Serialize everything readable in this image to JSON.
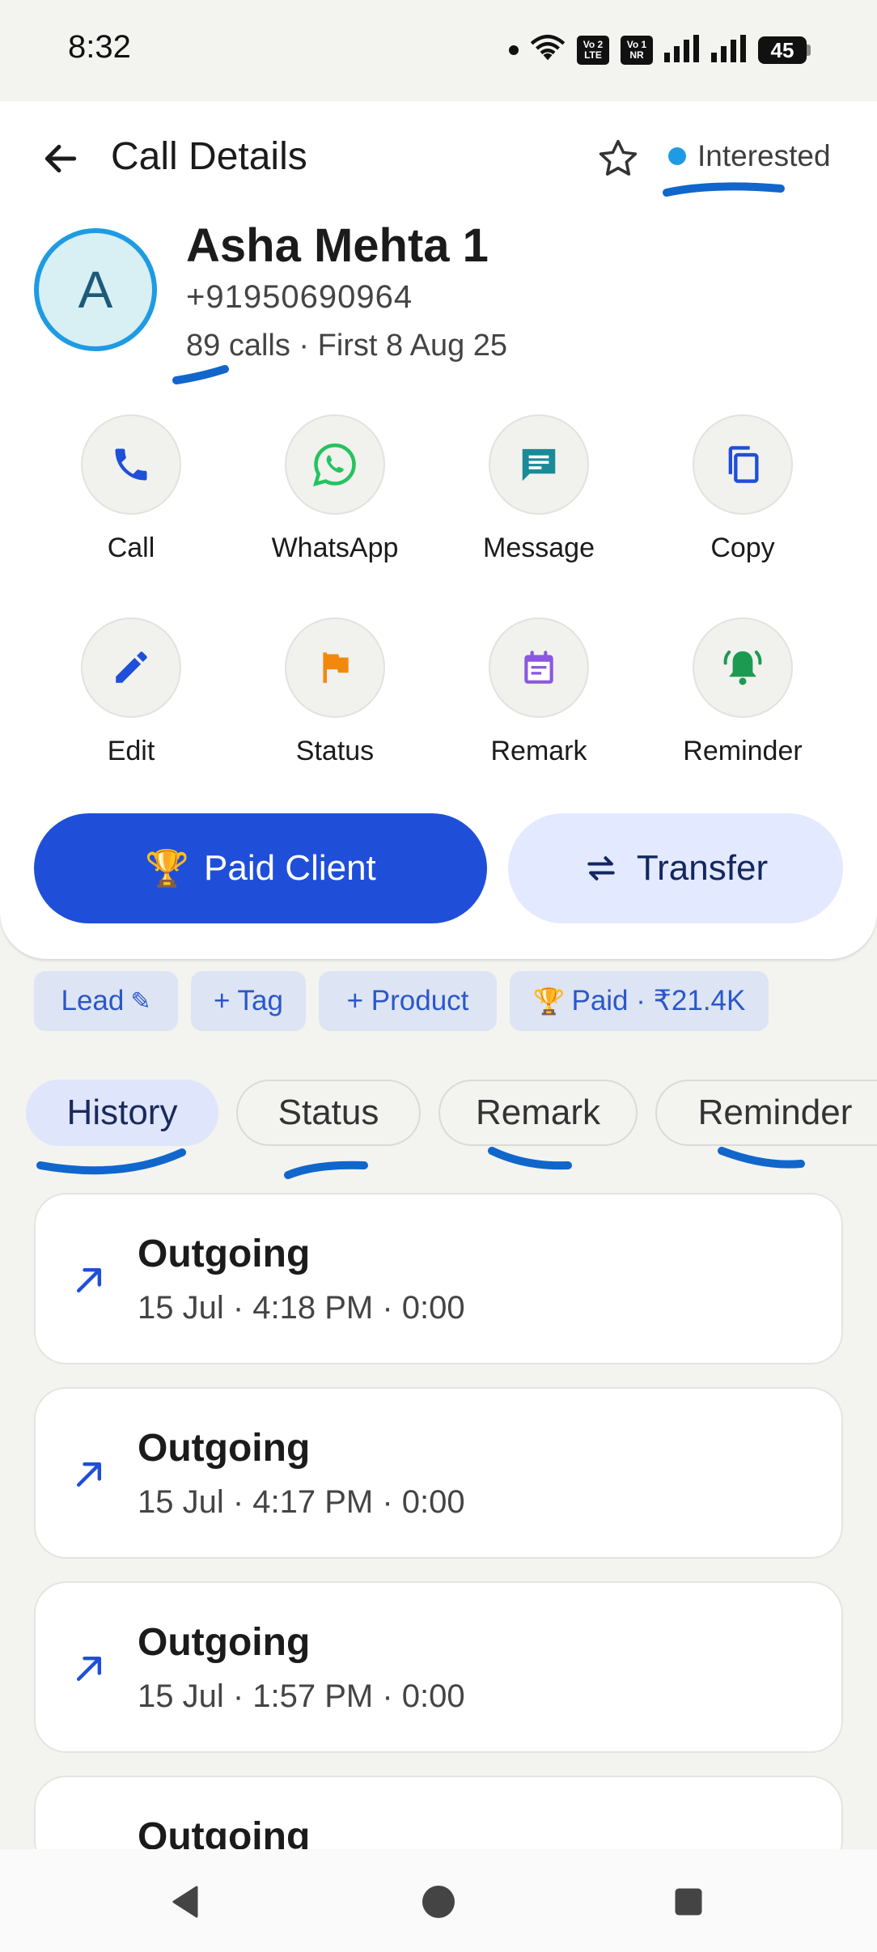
{
  "status_bar": {
    "time": "8:32",
    "volte1_top": "Vo 2",
    "volte1_bottom": "LTE",
    "volte2_top": "Vo 1",
    "volte2_bottom": "NR",
    "battery": "45"
  },
  "header": {
    "title": "Call Details",
    "lead_status": "Interested",
    "lead_status_color": "#1e9be3"
  },
  "contact": {
    "avatar_letter": "A",
    "name": "Asha Mehta 1",
    "phone": "+9195⁢0690964",
    "meta": "89 calls · First 8 Aug 25"
  },
  "actions": [
    {
      "label": "Call",
      "icon": "phone-icon"
    },
    {
      "label": "WhatsApp",
      "icon": "whatsapp-icon"
    },
    {
      "label": "Message",
      "icon": "message-icon"
    },
    {
      "label": "Copy",
      "icon": "copy-icon"
    },
    {
      "label": "Edit",
      "icon": "pencil-icon"
    },
    {
      "label": "Status",
      "icon": "flag-icon"
    },
    {
      "label": "Remark",
      "icon": "note-icon"
    },
    {
      "label": "Reminder",
      "icon": "bell-icon"
    }
  ],
  "buttons": {
    "paid_client": "Paid Client",
    "transfer": "Transfer",
    "trophy_emoji": "🏆"
  },
  "chips": {
    "lead": "Lead",
    "lead_icon": "✎",
    "tag": "+ Tag",
    "product": "+ Product",
    "paid": "Paid · ₹21.4K"
  },
  "tabs": [
    {
      "label": "History",
      "active": true
    },
    {
      "label": "Status",
      "active": false
    },
    {
      "label": "Remark",
      "active": false
    },
    {
      "label": "Reminder",
      "active": false
    }
  ],
  "calls": [
    {
      "type": "Outgoing",
      "detail": "15 Jul · 4:18 PM · 0:00"
    },
    {
      "type": "Outgoing",
      "detail": "15 Jul · 4:17 PM · 0:00"
    },
    {
      "type": "Outgoing",
      "detail": "15 Jul · 1:57 PM · 0:00"
    },
    {
      "type": "Outgoing",
      "detail": ""
    }
  ],
  "colors": {
    "primary": "#1f4fd9",
    "primary_light": "#e3e9ff",
    "whatsapp": "#25c35f",
    "message": "#1a8a97",
    "flag": "#f2890c",
    "remark": "#8a58e0",
    "reminder": "#1d9a52",
    "annotation": "#1166cc"
  }
}
